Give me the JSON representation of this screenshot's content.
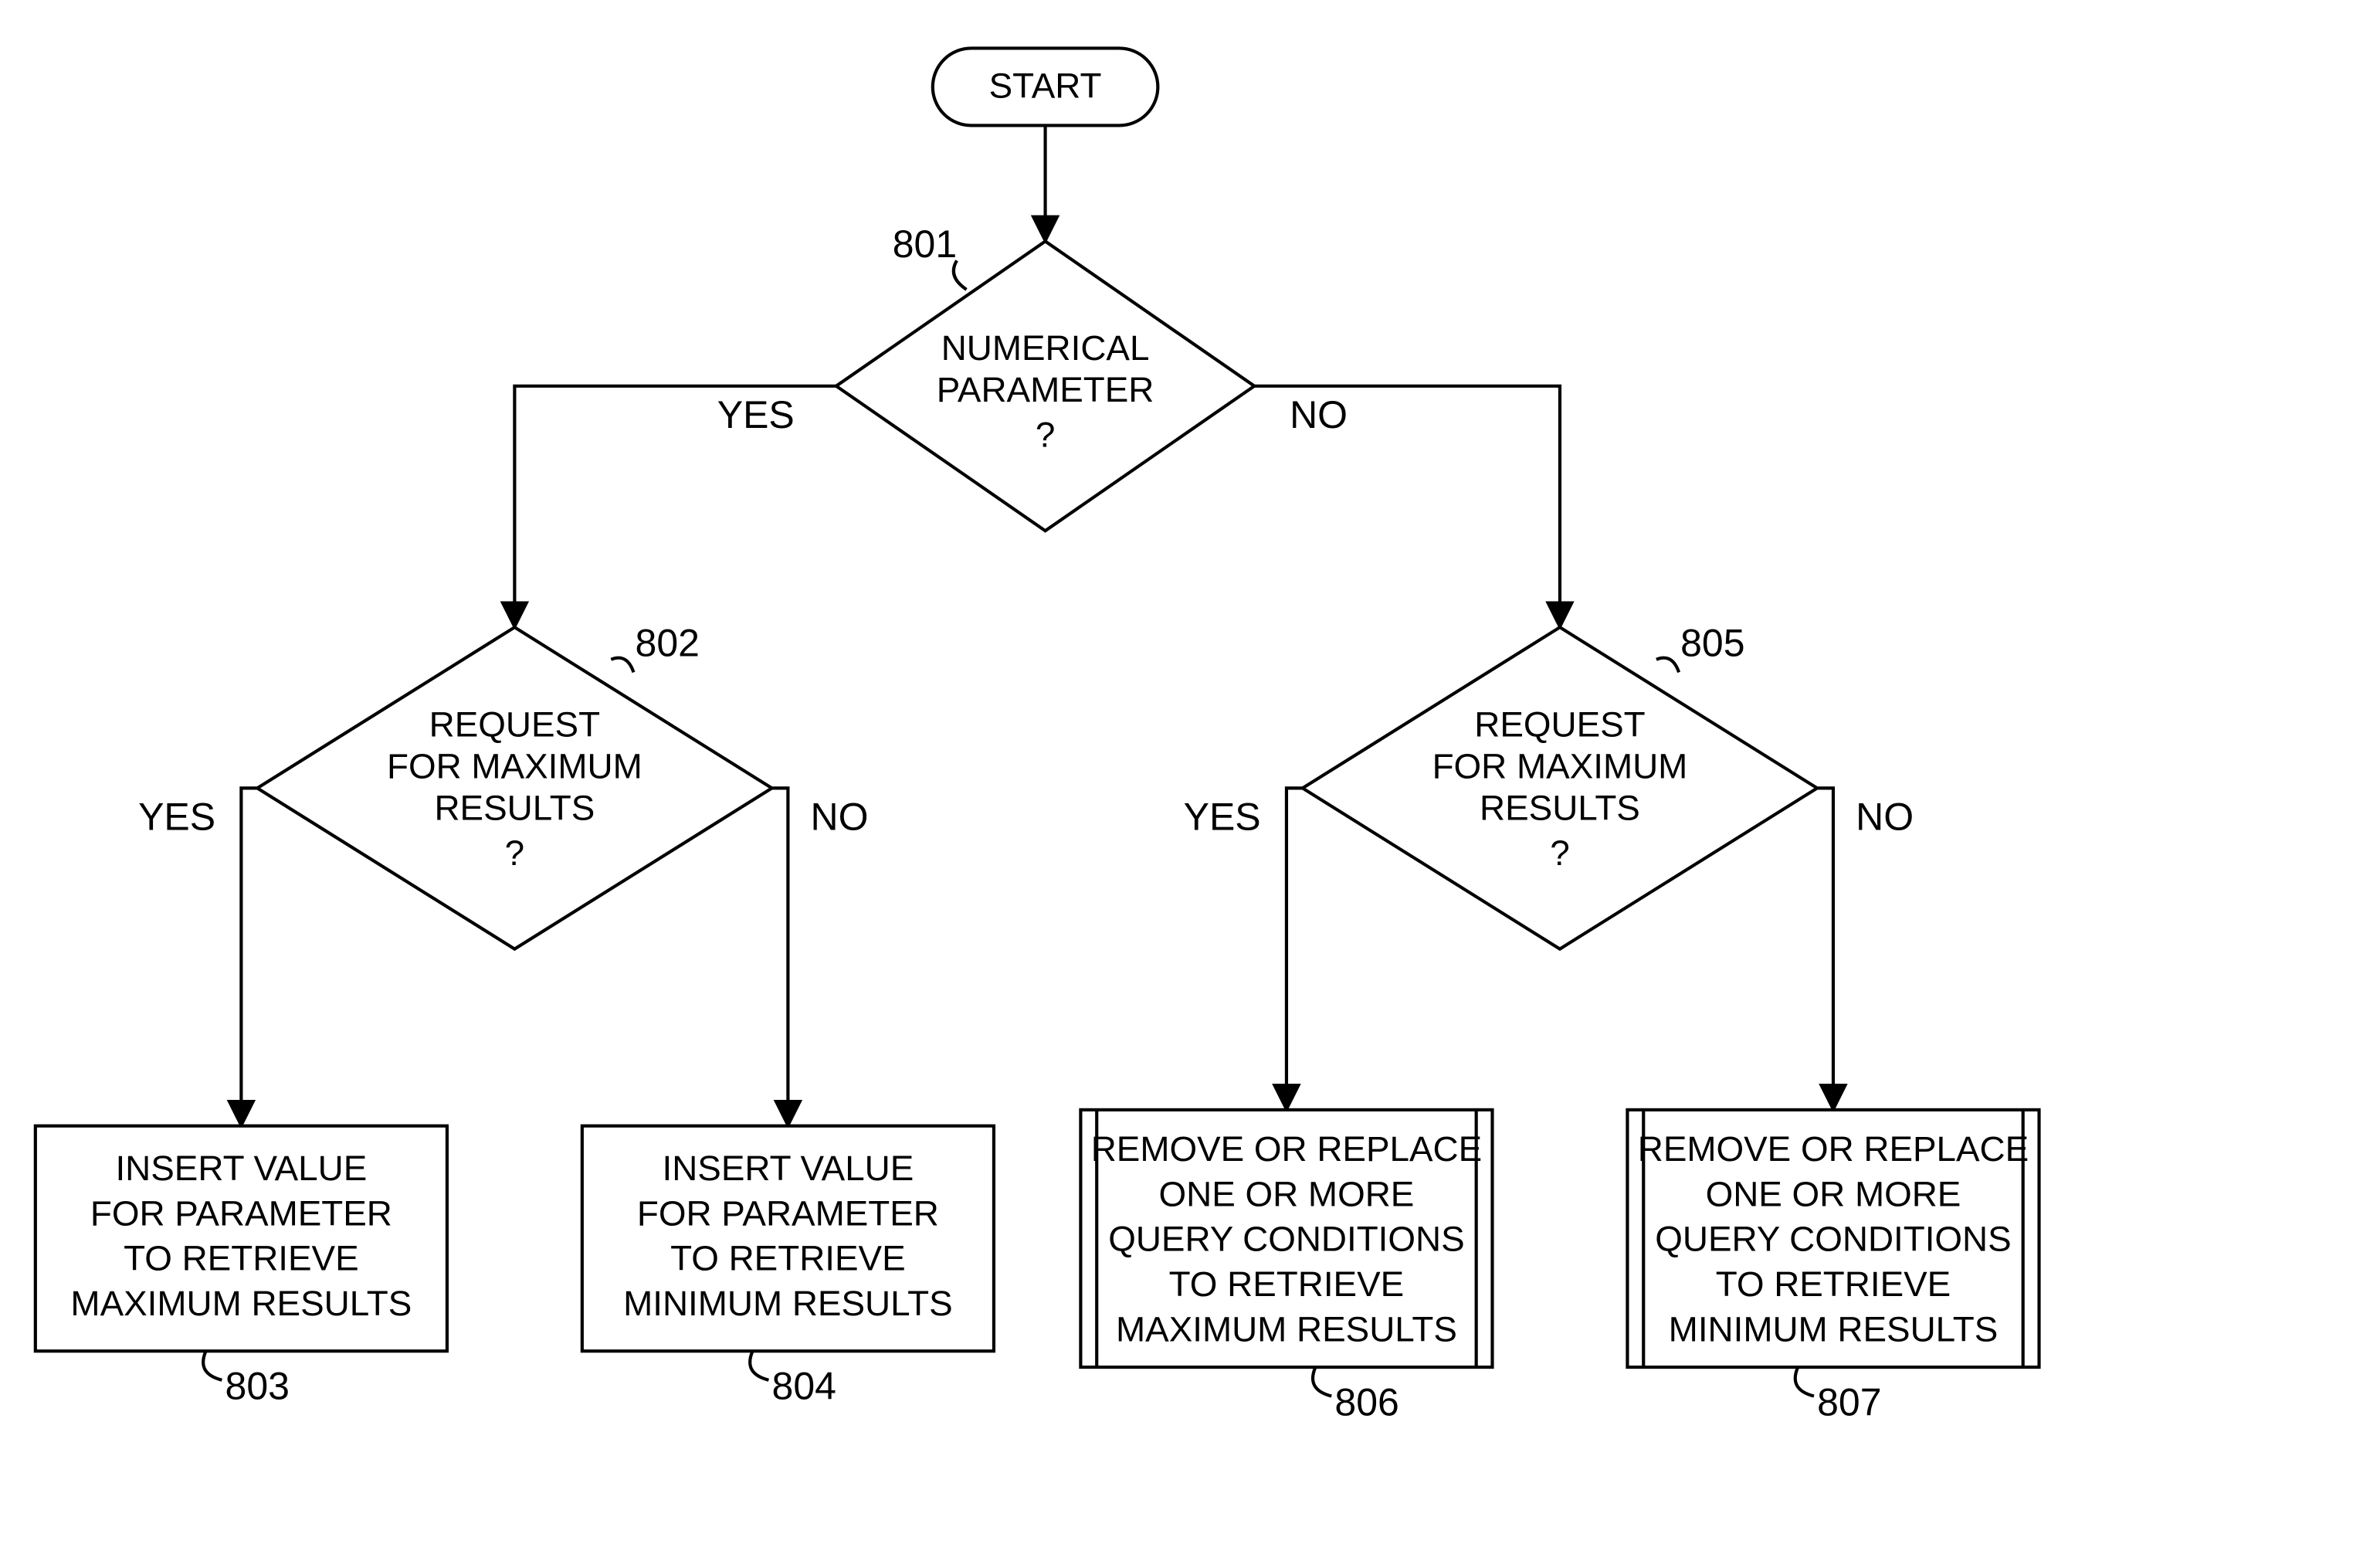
{
  "start": {
    "label": "START"
  },
  "d801": {
    "ref": "801",
    "line1": "NUMERICAL",
    "line2": "PARAMETER",
    "line3": "?",
    "yes": "YES",
    "no": "NO"
  },
  "d802": {
    "ref": "802",
    "line1": "REQUEST",
    "line2": "FOR MAXIMUM",
    "line3": "RESULTS",
    "line4": "?",
    "yes": "YES",
    "no": "NO"
  },
  "d805": {
    "ref": "805",
    "line1": "REQUEST",
    "line2": "FOR MAXIMUM",
    "line3": "RESULTS",
    "line4": "?",
    "yes": "YES",
    "no": "NO"
  },
  "p803": {
    "ref": "803",
    "line1": "INSERT VALUE",
    "line2": "FOR PARAMETER",
    "line3": "TO RETRIEVE",
    "line4": "MAXIMUM RESULTS"
  },
  "p804": {
    "ref": "804",
    "line1": "INSERT VALUE",
    "line2": "FOR PARAMETER",
    "line3": "TO RETRIEVE",
    "line4": "MINIMUM RESULTS"
  },
  "p806": {
    "ref": "806",
    "line1": "REMOVE OR REPLACE",
    "line2": "ONE OR MORE",
    "line3": "QUERY CONDITIONS",
    "line4": "TO RETRIEVE",
    "line5": "MAXIMUM RESULTS"
  },
  "p807": {
    "ref": "807",
    "line1": "REMOVE OR REPLACE",
    "line2": "ONE OR MORE",
    "line3": "QUERY CONDITIONS",
    "line4": "TO RETRIEVE",
    "line5": "MINIMUM RESULTS"
  }
}
